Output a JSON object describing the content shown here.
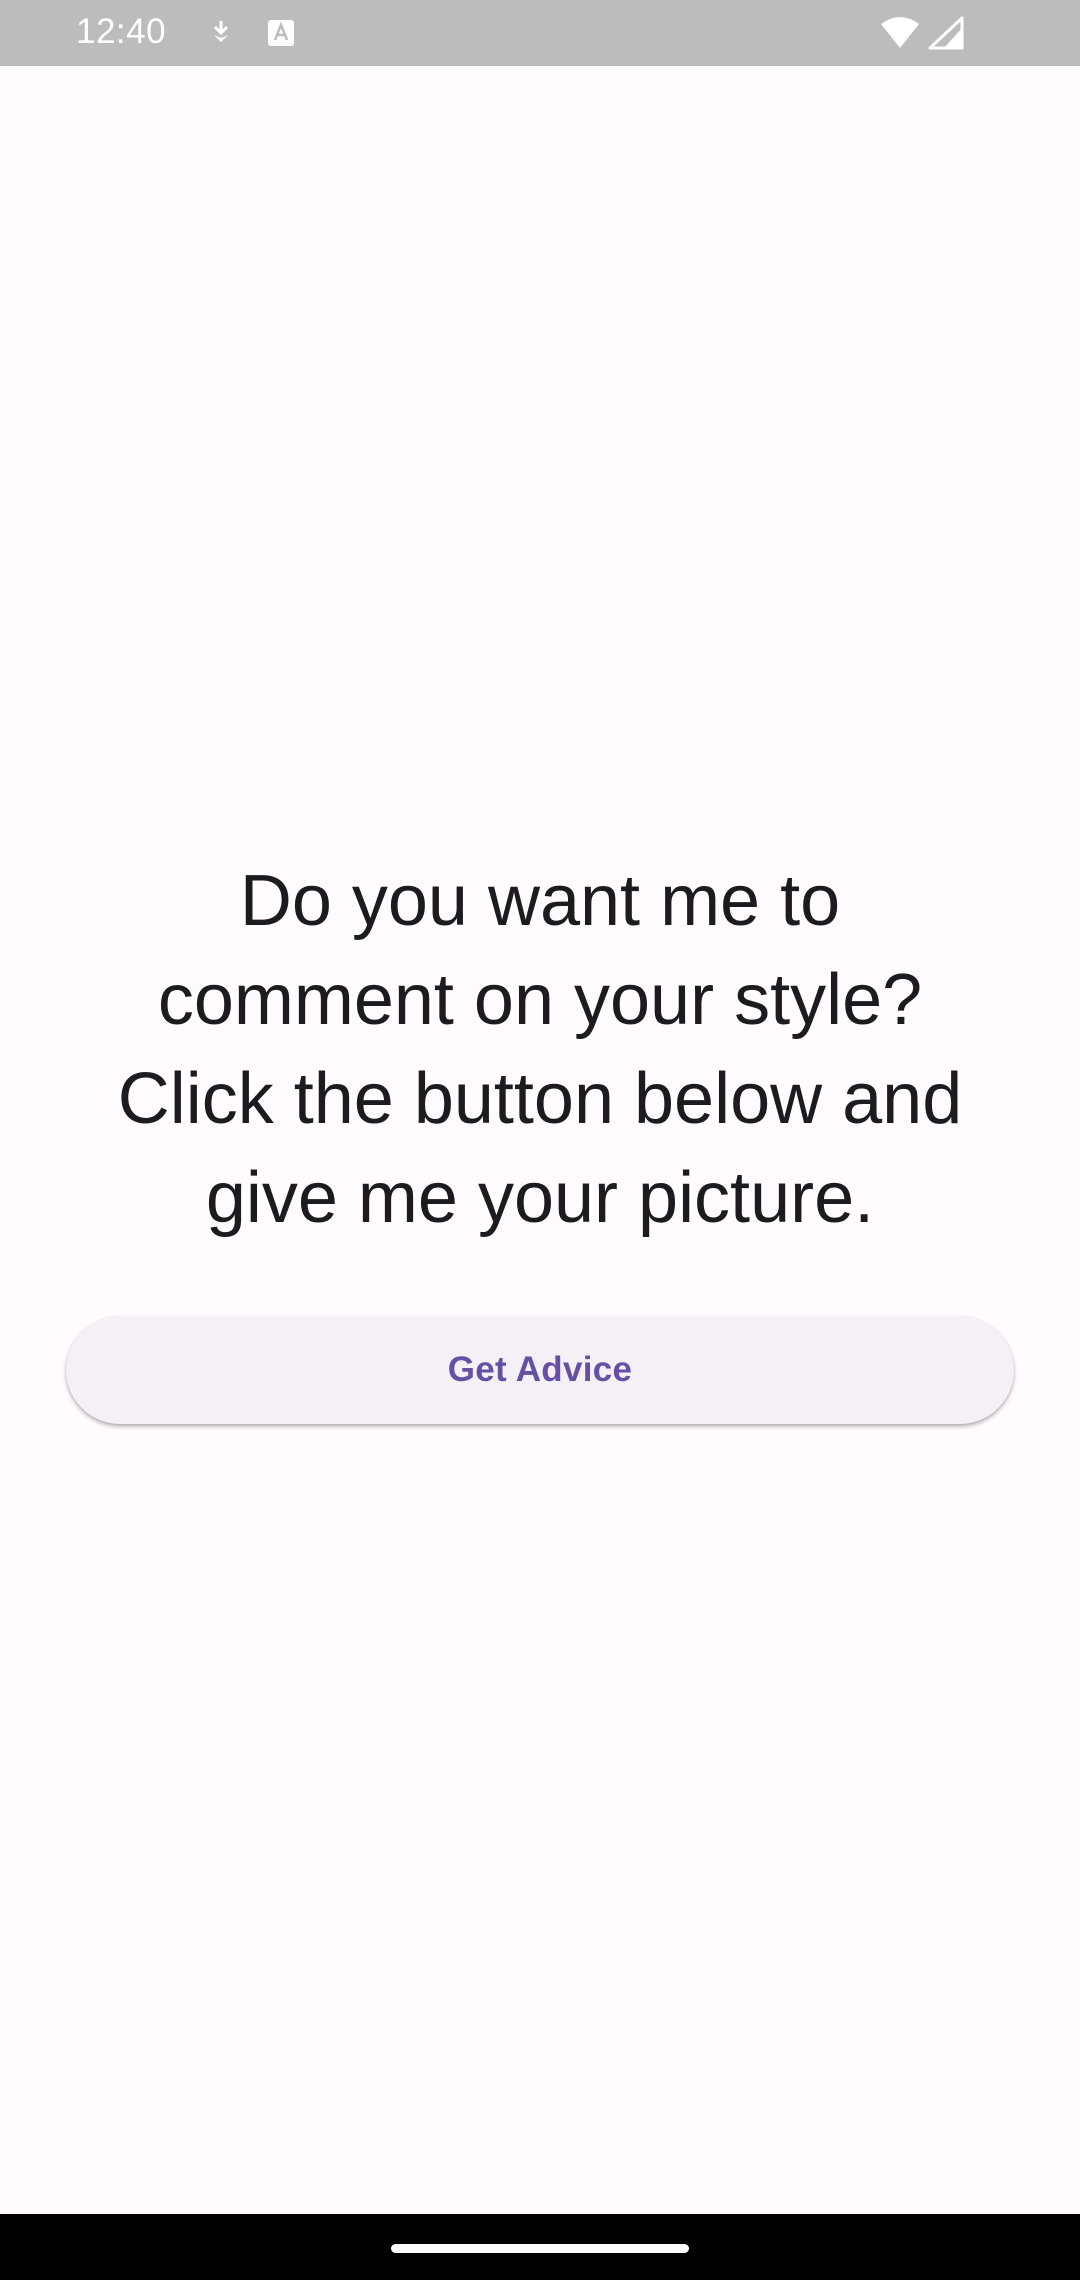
{
  "status_bar": {
    "time": "12:40",
    "icons": [
      "download-notification-icon",
      "text-notification-icon",
      "wifi-icon",
      "cellular-signal-icon"
    ]
  },
  "main": {
    "prompt_lines": [
      "Do you want me to",
      "comment on your style?",
      "Click the button below and",
      "give me your picture."
    ],
    "button_label": "Get Advice"
  },
  "colors": {
    "background": "#fffbfe",
    "status_bar": "#bdbcbd",
    "button_bg": "#f4f0f6",
    "button_text": "#6750a4",
    "text": "#1c1b1f"
  }
}
